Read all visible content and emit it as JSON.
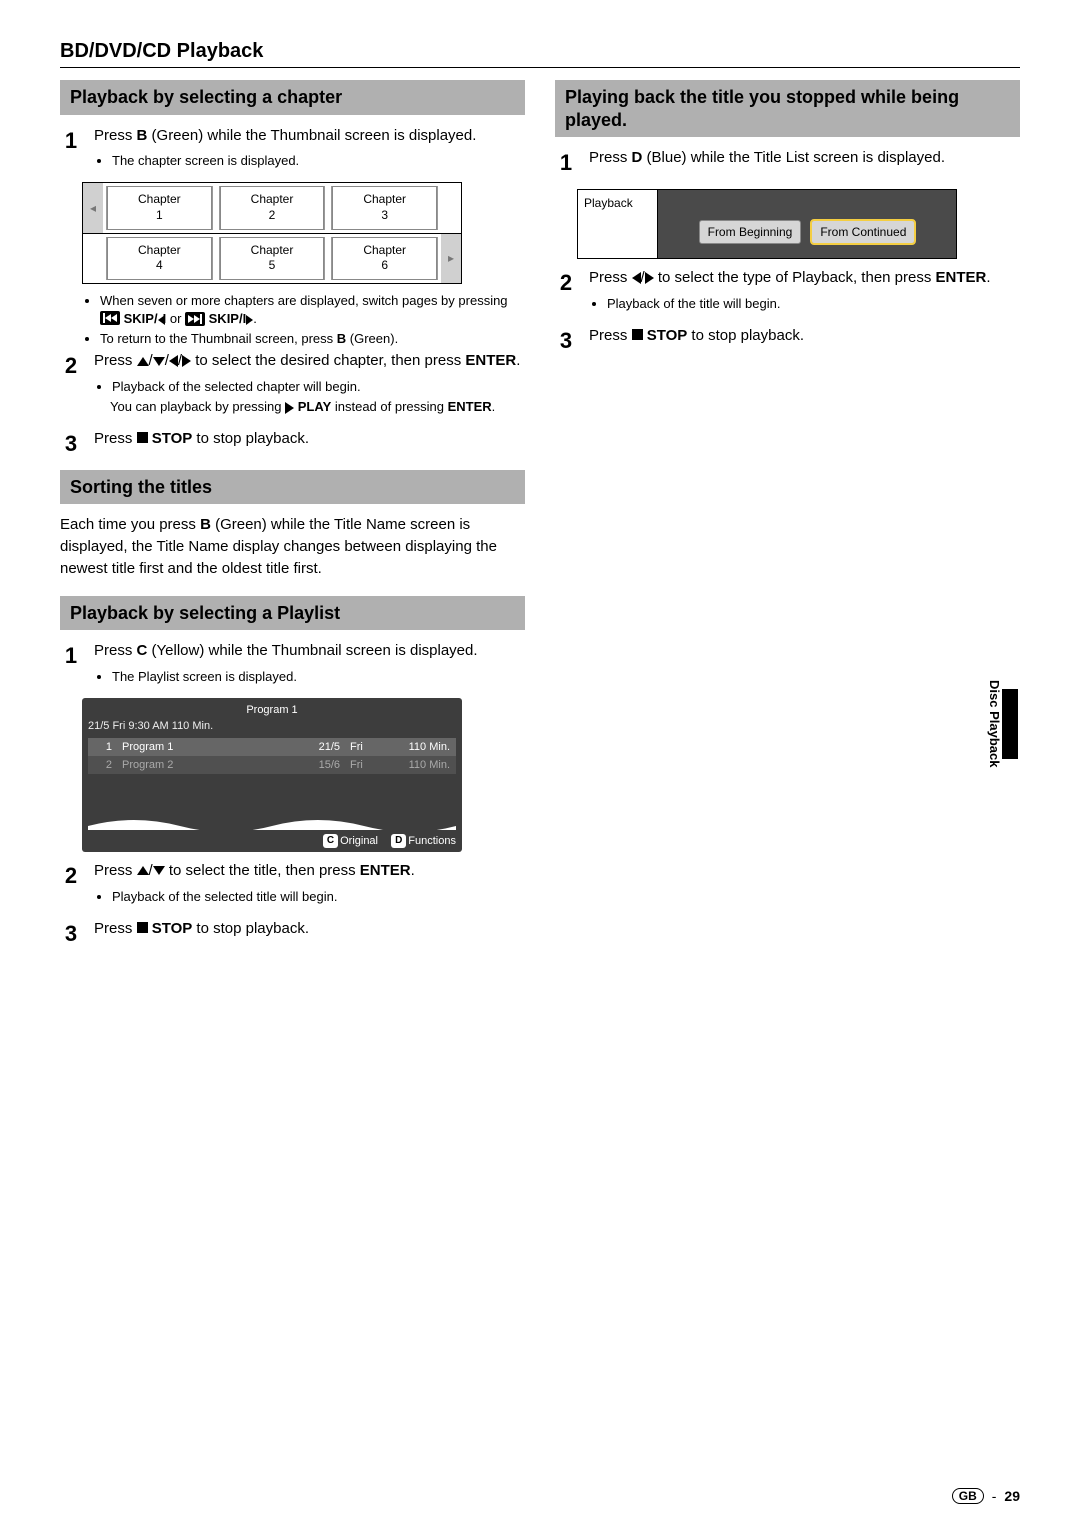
{
  "page_title": "BD/DVD/CD Playback",
  "side_tab": "Disc Playback",
  "footer": {
    "region": "GB",
    "sep": "-",
    "page": "29"
  },
  "left": {
    "sec1": {
      "heading": "Playback by selecting a chapter",
      "step1": {
        "num": "1",
        "text_a": "Press ",
        "key": "B",
        "text_b": " (Green) while the Thumbnail screen is displayed.",
        "b1": "The chapter screen is displayed."
      },
      "chapter": [
        "Chapter\n1",
        "Chapter\n2",
        "Chapter\n3",
        "Chapter\n4",
        "Chapter\n5",
        "Chapter\n6"
      ],
      "notes": {
        "n1a": "When seven or more chapters are displayed, switch pages by pressing ",
        "skip1": "SKIP/",
        "n1b": " or ",
        "skip2": "SKIP/",
        "n1c": ".",
        "n2a": "To return to the Thumbnail screen, press ",
        "n2b": "B",
        "n2c": " (Green)."
      },
      "step2": {
        "num": "2",
        "text_a": "Press ",
        "text_b": " to select the desired chapter, then press ",
        "enter": "ENTER",
        "text_c": ".",
        "b1": "Playback of the selected chapter will begin.",
        "b2a": "You can playback by pressing ",
        "play": "PLAY",
        "b2b": " instead of pressing ",
        "enter2": "ENTER",
        "b2c": "."
      },
      "step3": {
        "num": "3",
        "text_a": "Press ",
        "stop": "STOP",
        "text_b": " to stop playback."
      }
    },
    "sec2": {
      "heading": "Sorting the titles",
      "para_a": "Each time you press ",
      "key": "B",
      "para_b": " (Green) while the Title Name screen is displayed, the Title Name display changes between displaying the newest title first and the oldest title first."
    },
    "sec3": {
      "heading": "Playback by selecting a Playlist",
      "step1": {
        "num": "1",
        "text_a": "Press ",
        "key": "C",
        "text_b": " (Yellow) while the Thumbnail screen is displayed.",
        "b1": "The Playlist screen is displayed."
      },
      "playlist": {
        "title": "Program 1",
        "meta": "21/5   Fri   9:30 AM   110 Min.",
        "rows": [
          {
            "n": "1",
            "name": "Program 1",
            "date": "21/5",
            "day": "Fri",
            "dur": "110 Min."
          },
          {
            "n": "2",
            "name": "Program 2",
            "date": "15/6",
            "day": "Fri",
            "dur": "110 Min."
          }
        ],
        "foot": {
          "c": "C",
          "c_lbl": "Original",
          "d": "D",
          "d_lbl": "Functions"
        }
      },
      "step2": {
        "num": "2",
        "text_a": "Press ",
        "text_b": " to select the title, then press ",
        "enter": "ENTER",
        "text_c": ".",
        "b1": "Playback of the selected title will begin."
      },
      "step3": {
        "num": "3",
        "text_a": "Press ",
        "stop": "STOP",
        "text_b": " to stop playback."
      }
    }
  },
  "right": {
    "sec1": {
      "heading": "Playing back the title you stopped while being played.",
      "step1": {
        "num": "1",
        "text_a": "Press ",
        "key": "D",
        "text_b": " (Blue) while the Title List screen is displayed."
      },
      "popup": {
        "label": "Playback",
        "btn1": "From Beginning",
        "btn2": "From Continued"
      },
      "step2": {
        "num": "2",
        "text_a": "Press ",
        "text_b": " to select the type of Playback, then press ",
        "enter": "ENTER",
        "text_c": ".",
        "b1": "Playback of the title will begin."
      },
      "step3": {
        "num": "3",
        "text_a": "Press ",
        "stop": "STOP",
        "text_b": " to stop playback."
      }
    }
  }
}
